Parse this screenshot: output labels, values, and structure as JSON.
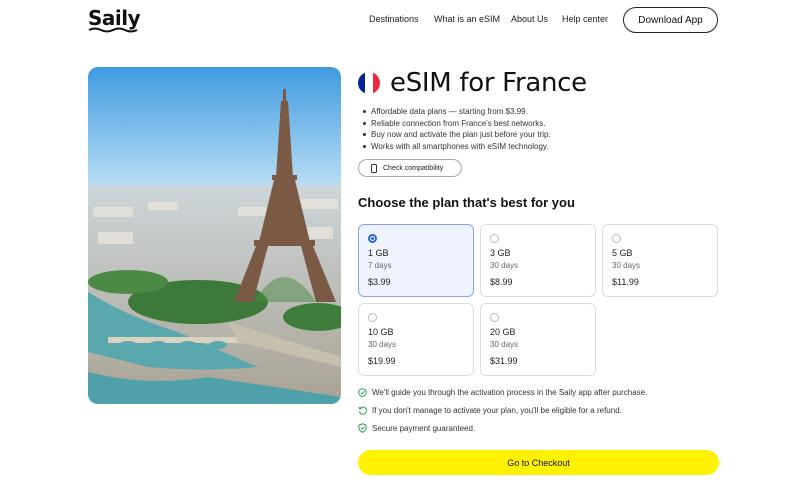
{
  "header": {
    "logo": "Saily",
    "nav": [
      "Destinations",
      "What is an eSIM",
      "About Us",
      "Help center"
    ],
    "download_label": "Download App"
  },
  "product": {
    "title": "eSIM for France",
    "flag_colors": [
      "#002395",
      "#ffffff",
      "#ED2939"
    ],
    "bullets": [
      "Affordable data plans — starting from $3.99.",
      "Reliable connection from France's best networks.",
      "Buy now and activate the plan just before your trip.",
      "Works with all smartphones with eSIM technology."
    ],
    "compat_label": "Check compatibility"
  },
  "plans": {
    "heading": "Choose the plan that's best for you",
    "items": [
      {
        "data": "1 GB",
        "days": "7 days",
        "price": "$3.99",
        "selected": true
      },
      {
        "data": "3 GB",
        "days": "30 days",
        "price": "$8.99",
        "selected": false
      },
      {
        "data": "5 GB",
        "days": "30 days",
        "price": "$11.99",
        "selected": false
      },
      {
        "data": "10 GB",
        "days": "30 days",
        "price": "$19.99",
        "selected": false
      },
      {
        "data": "20 GB",
        "days": "30 days",
        "price": "$31.99",
        "selected": false
      }
    ]
  },
  "guarantees": [
    {
      "icon": "check-circle-icon",
      "text": "We'll guide you through the activation process in the Saily app after purchase."
    },
    {
      "icon": "refund-icon",
      "text": "If you don't manage to activate your plan, you'll be eligible for a refund."
    },
    {
      "icon": "shield-check-icon",
      "text": "Secure payment guaranteed."
    }
  ],
  "checkout_label": "Go to Checkout",
  "colors": {
    "accent": "#fff200",
    "selected": "#2563eb",
    "guarantee": "#2e9e5b"
  }
}
